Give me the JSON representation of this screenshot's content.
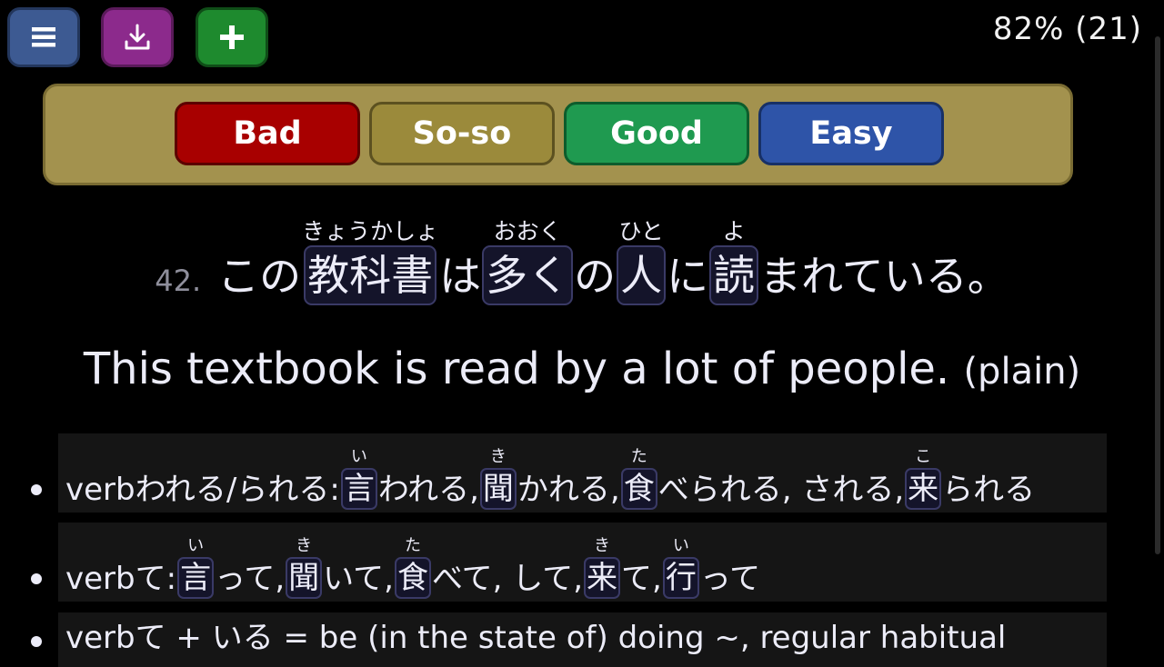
{
  "toolbar": {
    "menu_icon": "hamburger-menu-icon",
    "download_icon": "download-icon",
    "add_icon": "plus-icon",
    "menu_color": "#3d5a92",
    "download_color": "#8c2a8c",
    "add_color": "#1e8a2e"
  },
  "progress": "82% (21)",
  "rating": {
    "bad": "Bad",
    "soso": "So-so",
    "good": "Good",
    "easy": "Easy",
    "colors": {
      "bad": "#a80000",
      "soso": "#9b8a3b",
      "good": "#1f9a50",
      "easy": "#2e54a8",
      "panel": "#a3924e"
    }
  },
  "sentence": {
    "number": "42.",
    "parts": {
      "p1": "この",
      "k1": {
        "base": "教科書",
        "ruby": "きょうかしょ"
      },
      "p2": "は",
      "k2": {
        "base": "多く",
        "ruby": "おおく"
      },
      "p3": "の",
      "k3": {
        "base": "人",
        "ruby": "ひと"
      },
      "p4": "に",
      "k4": {
        "base": "読",
        "ruby": "よ"
      },
      "p5": "まれている。"
    }
  },
  "translation": {
    "text": "This textbook is read by a lot of people.",
    "note": "(plain)"
  },
  "notes": {
    "n1": {
      "label": "verbわれる/られる: ",
      "k1": {
        "base": "言",
        "ruby": "い"
      },
      "t1": "われる, ",
      "k2": {
        "base": "聞",
        "ruby": "き"
      },
      "t2": "かれる, ",
      "k3": {
        "base": "食",
        "ruby": "た"
      },
      "t3": "べられる, される, ",
      "k4": {
        "base": "来",
        "ruby": "こ"
      },
      "t4": "られる"
    },
    "n2": {
      "label": "verbて: ",
      "k1": {
        "base": "言",
        "ruby": "い"
      },
      "t1": "って, ",
      "k2": {
        "base": "聞",
        "ruby": "き"
      },
      "t2": "いて, ",
      "k3": {
        "base": "食",
        "ruby": "た"
      },
      "t3": "べて, して, ",
      "k4": {
        "base": "来",
        "ruby": "き"
      },
      "t4": "て, ",
      "k5": {
        "base": "行",
        "ruby": "い"
      },
      "t5": "って"
    },
    "n3": {
      "label": "verbて + いる = be (in the state of) doing ~, regular habitual"
    }
  }
}
